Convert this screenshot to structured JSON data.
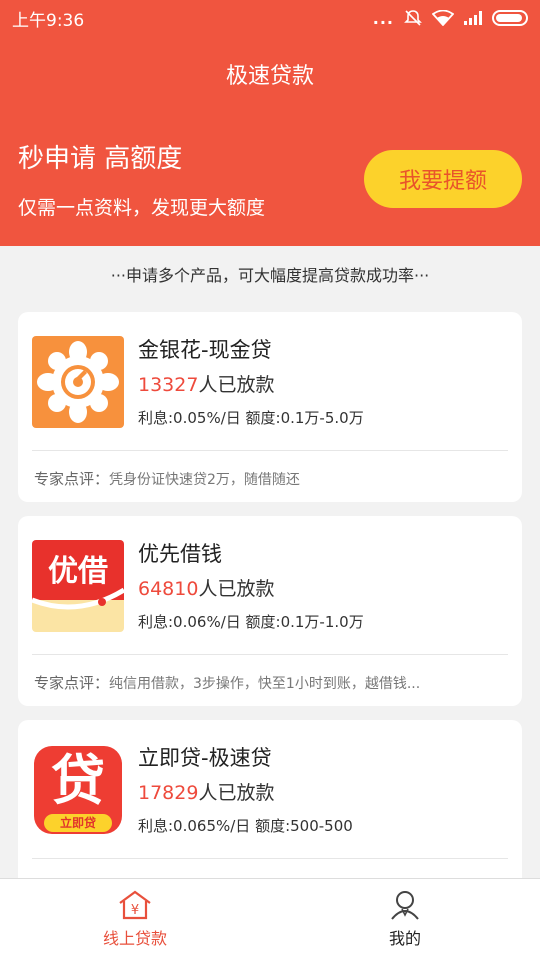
{
  "status_bar": {
    "time": "上午9:36",
    "dots": "..."
  },
  "header": {
    "title": "极速贷款",
    "slogan": "秒申请 高额度",
    "subslogan": "仅需一点资料，发现更大额度",
    "quota_button": "我要提额"
  },
  "tip": "···申请多个产品，可大幅度提高贷款成功率···",
  "products": [
    {
      "name": "金银花-现金贷",
      "count": "13327",
      "count_suffix": "人已放款",
      "terms": "利息:0.05%/日  额度:0.1万-5.0万",
      "review_label": "专家点评：",
      "review": "凭身份证快速贷2万，随借随还",
      "logo_icon": "flower-logo-icon"
    },
    {
      "name": "优先借钱",
      "count": "64810",
      "count_suffix": "人已放款",
      "terms": "利息:0.06%/日  额度:0.1万-1.0万",
      "review_label": "专家点评：",
      "review": "纯信用借款，3步操作，快至1小时到账，越借钱...",
      "logo_icon": "youjie-logo-icon",
      "logo_text": "优借"
    },
    {
      "name": "立即贷-极速贷",
      "count": "17829",
      "count_suffix": "人已放款",
      "terms": "利息:0.065%/日  额度:500-500",
      "logo_icon": "daikuan-logo-icon",
      "logo_text": "贷",
      "logo_subtext": "立即贷"
    }
  ],
  "tabs": [
    {
      "label": "线上贷款",
      "icon": "home-yuan-icon",
      "active": true
    },
    {
      "label": "我的",
      "icon": "person-icon",
      "active": false
    }
  ],
  "colors": {
    "primary": "#f0553f",
    "button": "#fcd22b",
    "accent": "#ee4a3c"
  }
}
